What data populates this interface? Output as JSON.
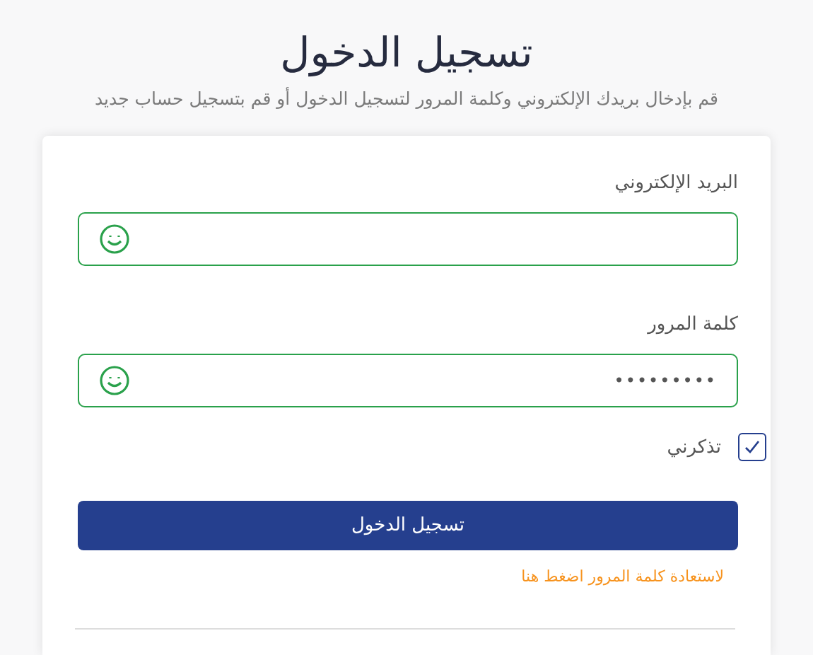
{
  "title": "تسجيل الدخول",
  "subtitle": "قم بإدخال بريدك الإلكتروني وكلمة المرور لتسجيل الدخول أو قم بتسجيل حساب جديد",
  "fields": [
    {
      "label": "البريد الإلكتروني",
      "valid": true
    },
    {
      "label": "كلمة المرور",
      "value": "•••••••••",
      "valid": true
    }
  ],
  "remember": {
    "label": "تذكرني",
    "checked": true
  },
  "submit": "تسجيل الدخول",
  "forgot_link": "لاستعادة كلمة المرور اضغط هنا"
}
